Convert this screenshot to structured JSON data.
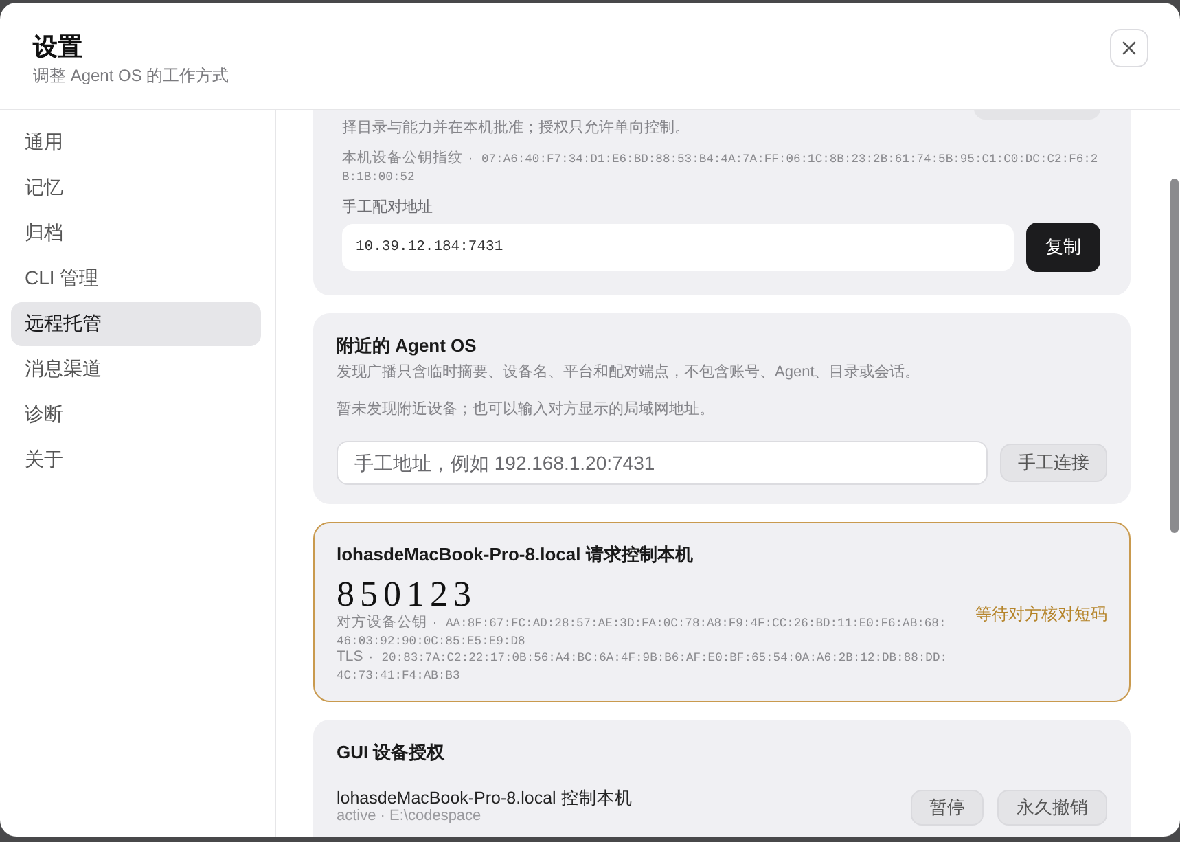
{
  "dialog": {
    "title": "设置",
    "subtitle": "调整 Agent OS 的工作方式"
  },
  "sidebar": {
    "items": [
      {
        "label": "通用",
        "selected": false
      },
      {
        "label": "记忆",
        "selected": false
      },
      {
        "label": "归档",
        "selected": false
      },
      {
        "label": "CLI 管理",
        "selected": false
      },
      {
        "label": "远程托管",
        "selected": true
      },
      {
        "label": "消息渠道",
        "selected": false
      },
      {
        "label": "诊断",
        "selected": false
      },
      {
        "label": "关于",
        "selected": false
      }
    ]
  },
  "pairing": {
    "description": "择目录与能力并在本机批准；授权只允许单向控制。",
    "fingerprint": {
      "label": "本机设备公钥指纹",
      "value": "· 07:A6:40:F7:34:D1:E6:BD:88:53:B4:4A:7A:FF:06:1C:8B:23:2B:61:74:5B:95:C1:C0:DC:C2:F6:2B:1B:00:52"
    },
    "address_label": "手工配对地址",
    "address": "10.39.12.184:7431",
    "copy_button": "复制"
  },
  "nearby": {
    "title": "附近的 Agent OS",
    "description": "发现广播只含临时摘要、设备名、平台和配对端点，不包含账号、Agent、目录或会话。",
    "empty_message": "暂未发现附近设备；也可以输入对方显示的局域网地址。",
    "address_placeholder": "手工地址，例如 192.168.1.20:7431",
    "connect_button": "手工连接"
  },
  "request": {
    "title": "lohasdeMacBook-Pro-8.local 请求控制本机",
    "code": "850123",
    "keys": [
      {
        "label": "对方设备公钥",
        "value": "· AA:8F:67:FC:AD:28:57:AE:3D:FA:0C:78:A8:F9:4F:CC:26:BD:11:E0:F6:AB:68:46:03:92:90:0C:85:E5:E9:D8"
      },
      {
        "label": "TLS",
        "value": "· 20:83:7A:C2:22:17:0B:56:A4:BC:6A:4F:9B:B6:AF:E0:BF:65:54:0A:A6:2B:12:DB:88:DD:4C:73:41:F4:AB:B3"
      }
    ],
    "status": "等待对方核对短码"
  },
  "gui_auth": {
    "title": "GUI 设备授权",
    "grants": [
      {
        "device": "lohasdeMacBook-Pro-8.local 控制本机",
        "detail": "active · E:\\codespace",
        "pause_button": "暂停",
        "revoke_button": "永久撤销"
      }
    ]
  }
}
